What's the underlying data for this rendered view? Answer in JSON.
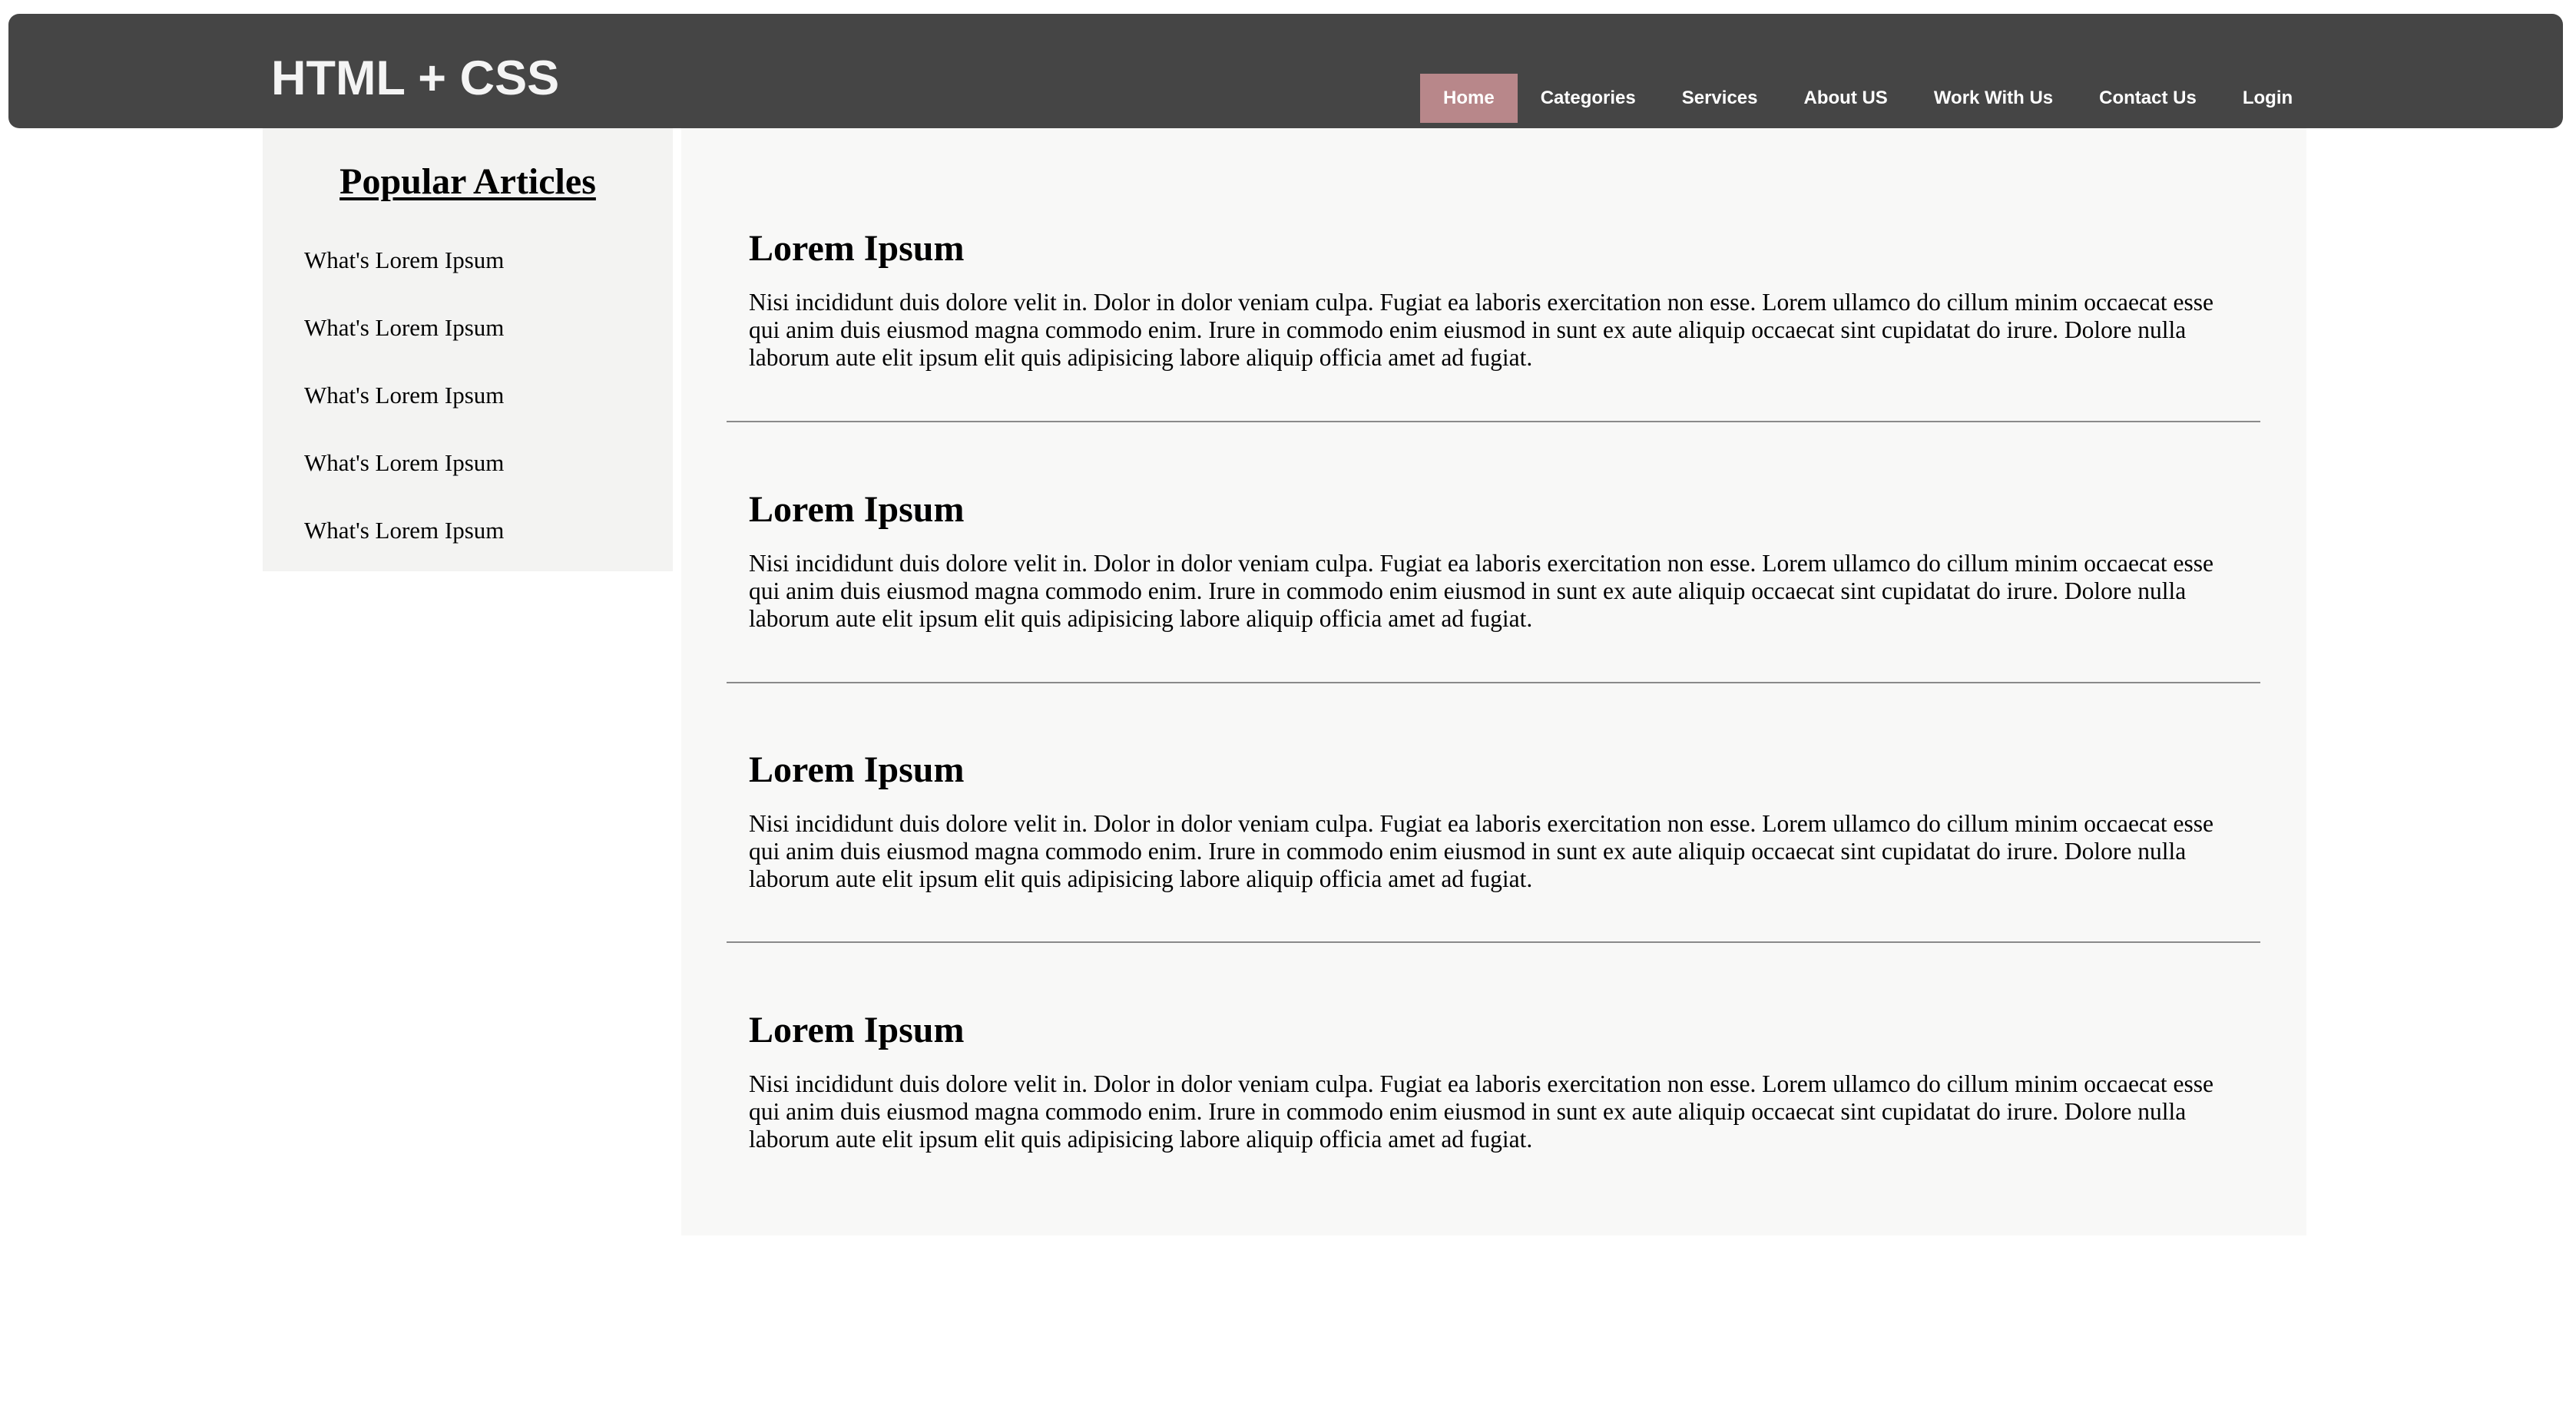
{
  "header": {
    "logo": "HTML + CSS",
    "nav": [
      {
        "label": "Home",
        "active": true
      },
      {
        "label": "Categories",
        "active": false
      },
      {
        "label": "Services",
        "active": false
      },
      {
        "label": "About US",
        "active": false
      },
      {
        "label": "Work With Us",
        "active": false
      },
      {
        "label": "Contact Us",
        "active": false
      },
      {
        "label": "Login",
        "active": false
      }
    ]
  },
  "sidebar": {
    "title": "Popular Articles",
    "items": [
      {
        "label": "What's Lorem Ipsum"
      },
      {
        "label": "What's Lorem Ipsum"
      },
      {
        "label": "What's Lorem Ipsum"
      },
      {
        "label": "What's Lorem Ipsum"
      },
      {
        "label": "What's Lorem Ipsum"
      }
    ]
  },
  "articles": [
    {
      "title": "Lorem Ipsum",
      "body": "Nisi incididunt duis dolore velit in. Dolor in dolor veniam culpa. Fugiat ea laboris exercitation non esse. Lorem ullamco do cillum minim occaecat esse qui anim duis eiusmod magna commodo enim. Irure in commodo enim eiusmod in sunt ex aute aliquip occaecat sint cupidatat do irure. Dolore nulla laborum aute elit ipsum elit quis adipisicing labore aliquip officia amet ad fugiat."
    },
    {
      "title": "Lorem Ipsum",
      "body": "Nisi incididunt duis dolore velit in. Dolor in dolor veniam culpa. Fugiat ea laboris exercitation non esse. Lorem ullamco do cillum minim occaecat esse qui anim duis eiusmod magna commodo enim. Irure in commodo enim eiusmod in sunt ex aute aliquip occaecat sint cupidatat do irure. Dolore nulla laborum aute elit ipsum elit quis adipisicing labore aliquip officia amet ad fugiat."
    },
    {
      "title": "Lorem Ipsum",
      "body": "Nisi incididunt duis dolore velit in. Dolor in dolor veniam culpa. Fugiat ea laboris exercitation non esse. Lorem ullamco do cillum minim occaecat esse qui anim duis eiusmod magna commodo enim. Irure in commodo enim eiusmod in sunt ex aute aliquip occaecat sint cupidatat do irure. Dolore nulla laborum aute elit ipsum elit quis adipisicing labore aliquip officia amet ad fugiat."
    },
    {
      "title": "Lorem Ipsum",
      "body": "Nisi incididunt duis dolore velit in. Dolor in dolor veniam culpa. Fugiat ea laboris exercitation non esse. Lorem ullamco do cillum minim occaecat esse qui anim duis eiusmod magna commodo enim. Irure in commodo enim eiusmod in sunt ex aute aliquip occaecat sint cupidatat do irure. Dolore nulla laborum aute elit ipsum elit quis adipisicing labore aliquip officia amet ad fugiat."
    }
  ],
  "colors": {
    "header_bg": "#454545",
    "nav_active_bg": "#b8878a",
    "sidebar_bg": "#f3f3f2",
    "main_bg": "#f8f8f7",
    "divider": "#8a8a8a"
  }
}
